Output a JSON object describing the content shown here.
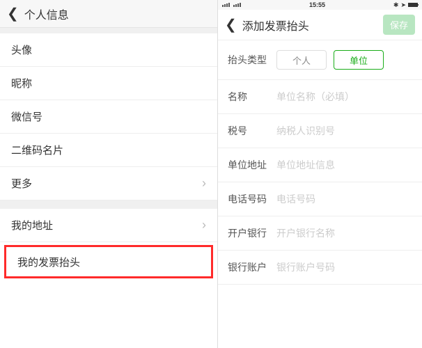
{
  "left": {
    "header_title": "个人信息",
    "rows": [
      {
        "label": "头像"
      },
      {
        "label": "昵称"
      },
      {
        "label": "微信号"
      },
      {
        "label": "二维码名片"
      },
      {
        "label": "更多",
        "chevron": true
      }
    ],
    "rows2": [
      {
        "label": "我的地址",
        "chevron": true
      },
      {
        "label": "我的发票抬头",
        "highlighted": true
      }
    ]
  },
  "right": {
    "status": {
      "time": "15:55",
      "bt": "✱",
      "gps": "➤"
    },
    "header_title": "添加发票抬头",
    "save_label": "保存",
    "type_label": "抬头类型",
    "seg_personal": "个人",
    "seg_company": "单位",
    "fields": [
      {
        "label": "名称",
        "placeholder": "单位名称（必填）"
      },
      {
        "label": "税号",
        "placeholder": "纳税人识别号"
      },
      {
        "label": "单位地址",
        "placeholder": "单位地址信息"
      },
      {
        "label": "电话号码",
        "placeholder": "电话号码"
      },
      {
        "label": "开户银行",
        "placeholder": "开户银行名称"
      },
      {
        "label": "银行账户",
        "placeholder": "银行账户号码"
      }
    ]
  }
}
